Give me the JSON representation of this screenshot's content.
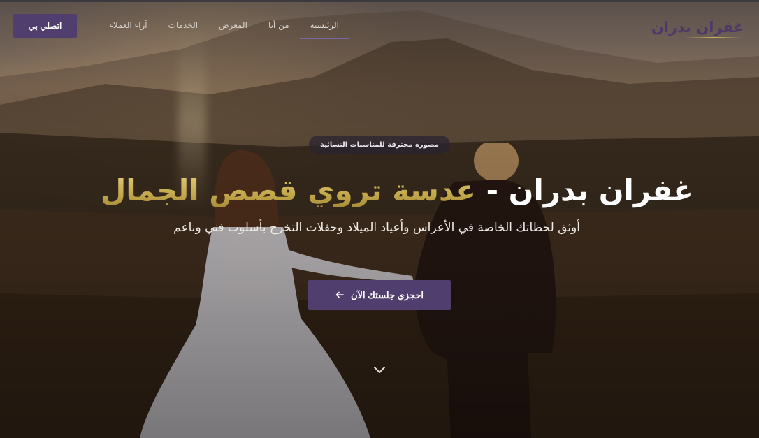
{
  "header": {
    "logo": "غفران بدران",
    "nav": [
      {
        "label": "الرئيسية",
        "active": true
      },
      {
        "label": "من أنا",
        "active": false
      },
      {
        "label": "المعرض",
        "active": false
      },
      {
        "label": "الخدمات",
        "active": false
      },
      {
        "label": "آراء العملاء",
        "active": false
      }
    ],
    "contact_button": "اتصلي بي"
  },
  "hero": {
    "badge": "مصورة محترفة للمناسبات النسائية",
    "title_main": "غفران بدران - ",
    "title_accent": "عدسة تروي قصص الجمال",
    "subtitle": "أوثق لحظاتك الخاصة في الأعراس وأعياد الميلاد وحفلات التخرج بأسلوب فني وناعم",
    "cta_label": "احجزي جلستك الآن",
    "cta_icon": "arrow-left-icon",
    "scroll_icon": "chevron-down-icon"
  },
  "colors": {
    "accent_purple": "#4f3e6e",
    "gold": "#cbb35d",
    "nav_underline": "#7a68a0"
  }
}
